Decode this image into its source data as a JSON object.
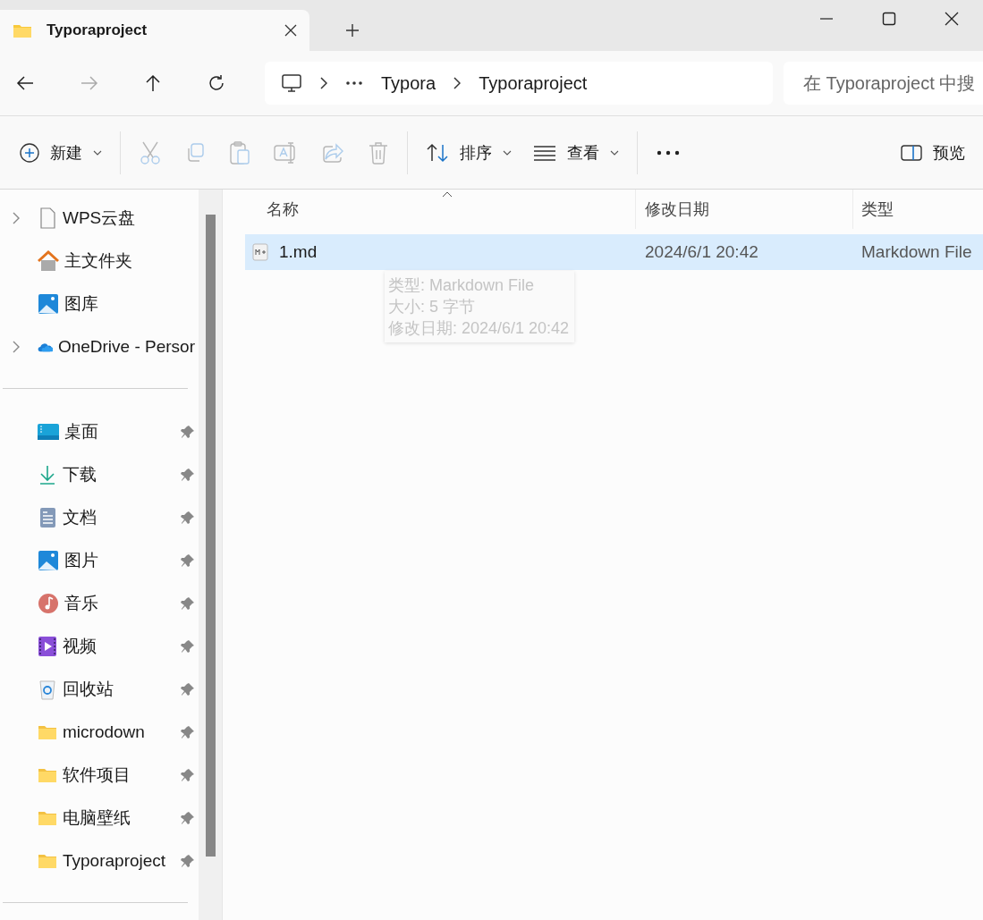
{
  "tab": {
    "title": "Typoraproject"
  },
  "breadcrumb": [
    "Typora",
    "Typoraproject"
  ],
  "search": {
    "placeholder": "在 Typoraproject 中搜"
  },
  "toolbar": [
    {
      "kind": "new",
      "label": "新建",
      "dropdown": true,
      "disabled": false
    },
    {
      "kind": "cut",
      "disabled": true
    },
    {
      "kind": "copy",
      "disabled": true
    },
    {
      "kind": "paste",
      "disabled": true
    },
    {
      "kind": "rename",
      "disabled": true
    },
    {
      "kind": "share",
      "disabled": true
    },
    {
      "kind": "delete",
      "disabled": true
    },
    {
      "kind": "sort",
      "label": "排序",
      "dropdown": true,
      "disabled": false
    },
    {
      "kind": "view",
      "label": "查看",
      "dropdown": true,
      "disabled": false
    },
    {
      "kind": "more",
      "disabled": false
    },
    {
      "kind": "preview",
      "label": "预览",
      "disabled": false
    }
  ],
  "sidebar": {
    "groups": [
      [
        {
          "kind": "doc",
          "label": "WPS云盘",
          "expandable": true,
          "pinned": false
        },
        {
          "kind": "home",
          "label": "主文件夹",
          "expandable": false,
          "pinned": false
        },
        {
          "kind": "gallery",
          "label": "图库",
          "expandable": false,
          "pinned": false
        },
        {
          "kind": "cloud",
          "label": "OneDrive - Persor",
          "expandable": true,
          "pinned": false
        }
      ],
      [
        {
          "kind": "desktop",
          "label": "桌面",
          "expandable": false,
          "pinned": true
        },
        {
          "kind": "download",
          "label": "下载",
          "expandable": false,
          "pinned": true
        },
        {
          "kind": "documents",
          "label": "文档",
          "expandable": false,
          "pinned": true
        },
        {
          "kind": "gallery",
          "label": "图片",
          "expandable": false,
          "pinned": true
        },
        {
          "kind": "music",
          "label": "音乐",
          "expandable": false,
          "pinned": true
        },
        {
          "kind": "video",
          "label": "视频",
          "expandable": false,
          "pinned": true
        },
        {
          "kind": "recycle",
          "label": "回收站",
          "expandable": false,
          "pinned": true
        },
        {
          "kind": "folder",
          "label": "microdown",
          "expandable": false,
          "pinned": true
        },
        {
          "kind": "folder",
          "label": "软件项目",
          "expandable": false,
          "pinned": true
        },
        {
          "kind": "folder",
          "label": "电脑壁纸",
          "expandable": false,
          "pinned": true
        },
        {
          "kind": "folder",
          "label": "Typoraproject",
          "expandable": false,
          "pinned": true
        }
      ]
    ]
  },
  "table": {
    "columns": [
      {
        "label": "名称",
        "sorted": true
      },
      {
        "label": "修改日期",
        "sorted": false
      },
      {
        "label": "类型",
        "sorted": false
      }
    ],
    "rows": [
      {
        "name": "1.md",
        "modified": "2024/6/1 20:42",
        "type": "Markdown File",
        "selected": true
      }
    ]
  },
  "tooltip": {
    "lines": [
      "类型: Markdown File",
      "大小: 5 字节",
      "修改日期: 2024/6/1 20:42"
    ]
  }
}
